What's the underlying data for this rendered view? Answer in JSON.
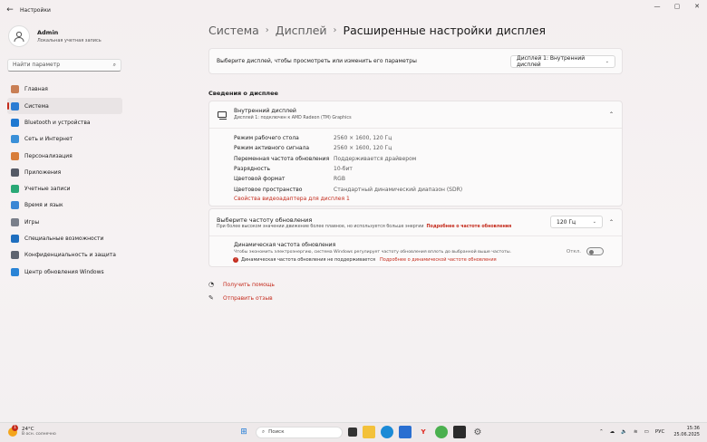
{
  "window": {
    "title": "Настройки",
    "back": "←",
    "minimize": "—",
    "maximize": "▢",
    "close": "✕"
  },
  "user": {
    "name": "Admin",
    "type": "Локальная учетная запись"
  },
  "search": {
    "placeholder": "Найти параметр"
  },
  "nav": [
    {
      "label": "Главная",
      "icon": "home-icon",
      "color": "#c97f55"
    },
    {
      "label": "Система",
      "icon": "system-icon",
      "color": "#2b7cd3"
    },
    {
      "label": "Bluetooth и устройства",
      "icon": "bluetooth-icon",
      "color": "#1f78d1"
    },
    {
      "label": "Сеть и Интернет",
      "icon": "network-icon",
      "color": "#3a8fd8"
    },
    {
      "label": "Персонализация",
      "icon": "brush-icon",
      "color": "#d87d3a"
    },
    {
      "label": "Приложения",
      "icon": "apps-icon",
      "color": "#555a66"
    },
    {
      "label": "Учетные записи",
      "icon": "accounts-icon",
      "color": "#2aa876"
    },
    {
      "label": "Время и язык",
      "icon": "time-icon",
      "color": "#3a86d4"
    },
    {
      "label": "Игры",
      "icon": "games-icon",
      "color": "#7a7f8a"
    },
    {
      "label": "Специальные возможности",
      "icon": "accessibility-icon",
      "color": "#1f6fbf"
    },
    {
      "label": "Конфиденциальность и защита",
      "icon": "shield-icon",
      "color": "#5e6470"
    },
    {
      "label": "Центр обновления Windows",
      "icon": "update-icon",
      "color": "#2a84d6"
    }
  ],
  "breadcrumb": {
    "a": "Система",
    "b": "Дисплей",
    "c": "Расширенные настройки дисплея",
    "sep": "›"
  },
  "select_display": {
    "label": "Выберите дисплей, чтобы просмотреть или изменить его параметры",
    "value": "Дисплей 1: Внутренний дисплей"
  },
  "section_title": "Сведения о дисплее",
  "display": {
    "name": "Внутренний дисплей",
    "sub": "Дисплей 1: подключен к AMD Radeon (TM) Graphics",
    "props": [
      {
        "k": "Режим рабочего стола",
        "v": "2560 × 1600, 120 Гц"
      },
      {
        "k": "Режим активного сигнала",
        "v": "2560 × 1600, 120 Гц"
      },
      {
        "k": "Переменная частота обновления",
        "v": "Поддерживается драйвером"
      },
      {
        "k": "Разрядность",
        "v": "10-бит"
      },
      {
        "k": "Цветовой формат",
        "v": "RGB"
      },
      {
        "k": "Цветовое пространство",
        "v": "Стандартный динамический диапазон (SDR)"
      }
    ],
    "adapter_link": "Свойства видеоадаптера для дисплея 1"
  },
  "refresh": {
    "title": "Выберите частоту обновления",
    "desc": "При более высоком значении движение более плавное, но используется больше энергии",
    "link": "Подробнее о частоте обновления",
    "value": "120 Гц",
    "dynamic_title": "Динамическая частота обновления",
    "dynamic_desc": "Чтобы экономить электроэнергию, система Windows регулирует частоту обновления вплоть до выбранной выше частоты.",
    "dynamic_warning": "Динамическая частота обновления не поддерживается",
    "dynamic_link": "Подробнее о динамической частоте обновления",
    "toggle_state": "Откл."
  },
  "help": {
    "get_help": "Получить помощь",
    "feedback": "Отправить отзыв"
  },
  "taskbar": {
    "weather_temp": "24°C",
    "weather_desc": "В осн. солнечно",
    "weather_badge": "1",
    "search": "Поиск",
    "lang": "РУС",
    "time": "15:36",
    "date": "25.06.2025"
  }
}
